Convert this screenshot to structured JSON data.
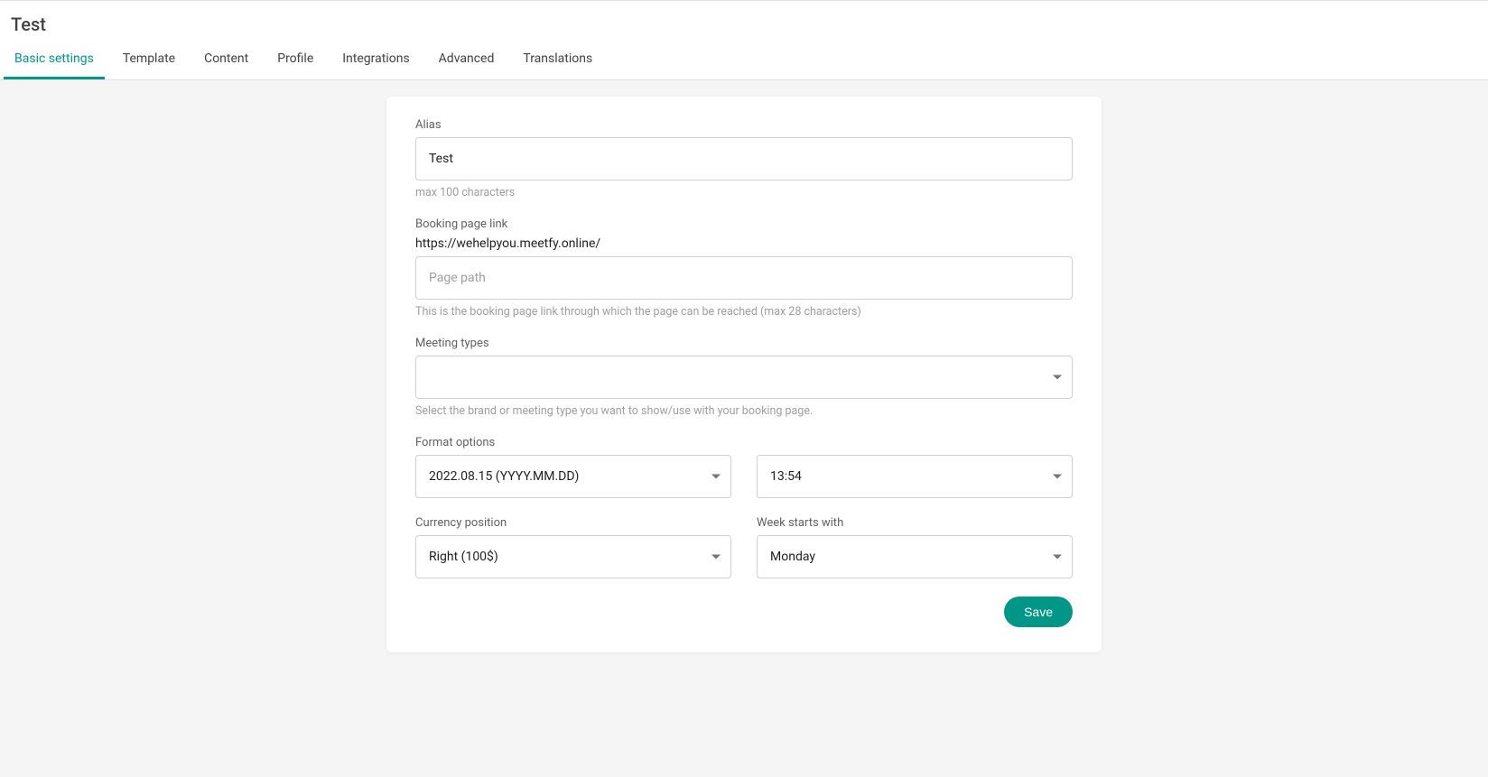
{
  "header": {
    "title": "Test",
    "tabs": [
      {
        "label": "Basic settings",
        "active": true
      },
      {
        "label": "Template",
        "active": false
      },
      {
        "label": "Content",
        "active": false
      },
      {
        "label": "Profile",
        "active": false
      },
      {
        "label": "Integrations",
        "active": false
      },
      {
        "label": "Advanced",
        "active": false
      },
      {
        "label": "Translations",
        "active": false
      }
    ]
  },
  "form": {
    "alias": {
      "label": "Alias",
      "value": "Test",
      "helper": "max 100 characters"
    },
    "booking_link": {
      "label": "Booking page link",
      "url_prefix": "https://wehelpyou.meetfy.online/",
      "value": "",
      "placeholder": "Page path",
      "helper": "This is the booking page link through which the page can be reached (max 28 characters)"
    },
    "meeting_types": {
      "label": "Meeting types",
      "value": "",
      "helper": "Select the brand or meeting type you want to show/use with your booking page."
    },
    "format_options": {
      "label": "Format options",
      "date_value": "2022.08.15 (YYYY.MM.DD)",
      "time_value": "13:54"
    },
    "currency_position": {
      "label": "Currency position",
      "value": "Right (100$)"
    },
    "week_starts": {
      "label": "Week starts with",
      "value": "Monday"
    },
    "save_label": "Save"
  },
  "colors": {
    "accent": "#009688"
  }
}
